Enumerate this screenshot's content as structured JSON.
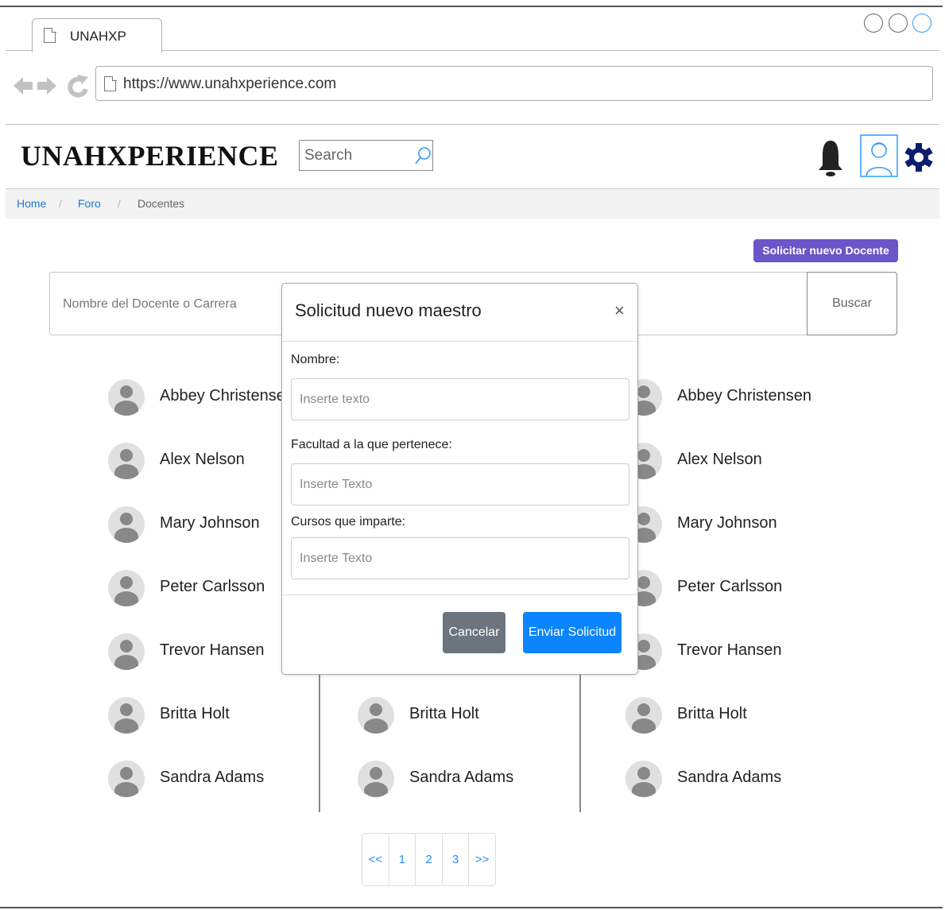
{
  "browser": {
    "tab_title": "UNAHXP",
    "url": "https://www.unahxperience.com"
  },
  "header": {
    "brand": "UNAHXPERIENCE",
    "search_placeholder": "Search"
  },
  "breadcrumb": {
    "items": [
      "Home",
      "Foro",
      "Docentes"
    ],
    "separator": "/"
  },
  "actions": {
    "request_button": "Solicitar nuevo Docente"
  },
  "teacher_search": {
    "placeholder": "Nombre del Docente o Carrera",
    "button": "Buscar"
  },
  "teachers": {
    "col1": [
      "Abbey Christensen",
      "Alex Nelson",
      "Mary Johnson",
      "Peter Carlsson",
      "Trevor Hansen",
      "Britta Holt",
      "Sandra Adams"
    ],
    "col2": [
      "Britta Holt",
      "Sandra Adams"
    ],
    "col3": [
      "Abbey Christensen",
      "Alex Nelson",
      "Mary Johnson",
      "Peter Carlsson",
      "Trevor Hansen",
      "Britta Holt",
      "Sandra Adams"
    ]
  },
  "pagination": [
    "<<",
    "1",
    "2",
    "3",
    ">>"
  ],
  "modal": {
    "title": "Solicitud nuevo maestro",
    "close": "×",
    "fields": [
      {
        "label": "Nombre:",
        "placeholder": "Inserte texto"
      },
      {
        "label": "Facultad a la que pertenece:",
        "placeholder": "Inserte Texto"
      },
      {
        "label": "Cursos que imparte:",
        "placeholder": "Inserte Texto"
      }
    ],
    "cancel": "Cancelar",
    "submit": "Enviar Solicitud"
  },
  "colors": {
    "accent_purple": "#6a55c9",
    "primary_blue": "#0b84ff",
    "secondary_gray": "#6c757d",
    "link_blue": "#2277cc"
  }
}
